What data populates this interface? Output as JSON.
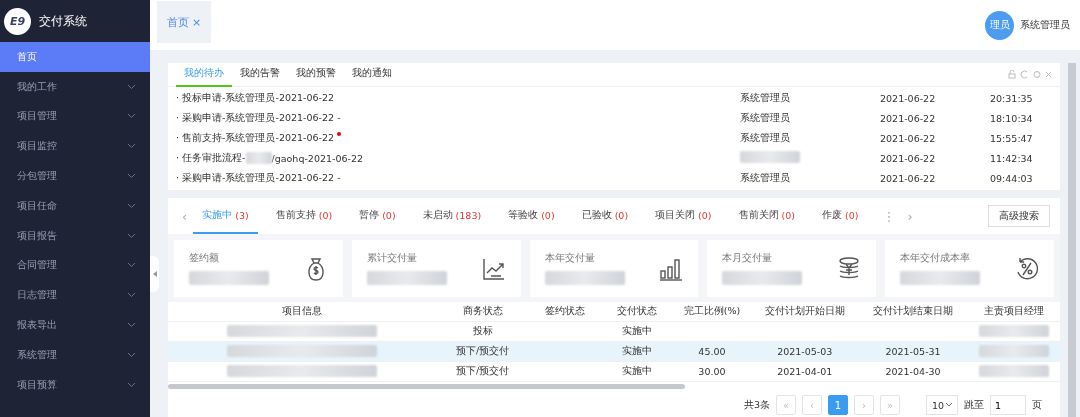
{
  "app": {
    "logo": "E9",
    "title": "交付系统"
  },
  "sidebar": {
    "items": [
      {
        "label": "首页",
        "selected": true,
        "expandable": false
      },
      {
        "label": "我的工作",
        "selected": false,
        "expandable": true
      },
      {
        "label": "项目管理",
        "selected": false,
        "expandable": true
      },
      {
        "label": "项目监控",
        "selected": false,
        "expandable": true
      },
      {
        "label": "分包管理",
        "selected": false,
        "expandable": true
      },
      {
        "label": "项目任命",
        "selected": false,
        "expandable": true
      },
      {
        "label": "项目报告",
        "selected": false,
        "expandable": true
      },
      {
        "label": "合同管理",
        "selected": false,
        "expandable": true
      },
      {
        "label": "日志管理",
        "selected": false,
        "expandable": true
      },
      {
        "label": "报表导出",
        "selected": false,
        "expandable": true
      },
      {
        "label": "系统管理",
        "selected": false,
        "expandable": true
      },
      {
        "label": "项目预算",
        "selected": false,
        "expandable": true
      }
    ]
  },
  "page_tabs": [
    {
      "label": "首页",
      "close": "×",
      "selected": true
    }
  ],
  "user": {
    "avatar": "理员",
    "name": "系统管理员"
  },
  "todo_panel": {
    "bullet": "·",
    "tabs": [
      {
        "label": "我的待办",
        "selected": true
      },
      {
        "label": "我的告警",
        "selected": false
      },
      {
        "label": "我的预警",
        "selected": false
      },
      {
        "label": "我的通知",
        "selected": false
      }
    ],
    "items": [
      {
        "title": "投标申请-系统管理员-2021-06-22",
        "unread": false,
        "user": "系统管理员",
        "date": "2021-06-22",
        "time": "20:31:35"
      },
      {
        "title": "采购申请-系统管理员-2021-06-22 -",
        "unread": false,
        "user": "系统管理员",
        "date": "2021-06-22",
        "time": "18:10:34"
      },
      {
        "title": "售前支持-系统管理员-2021-06-22",
        "unread": true,
        "user": "系统管理员",
        "date": "2021-06-22",
        "time": "15:55:47"
      },
      {
        "title": "任务审批流程-",
        "title_redacted": true,
        "title_tail": "/gaohq-2021-06-22",
        "unread": false,
        "user_redacted": true,
        "date": "2021-06-22",
        "time": "11:42:34"
      },
      {
        "title": "采购申请-系统管理员-2021-06-22 -",
        "unread": false,
        "user": "系统管理员",
        "date": "2021-06-22",
        "time": "09:44:03"
      }
    ]
  },
  "project_panel": {
    "prev": "‹",
    "tabs": [
      {
        "label": "实施中",
        "count": "(3)",
        "selected": true
      },
      {
        "label": "售前支持",
        "count": "(0)",
        "selected": false
      },
      {
        "label": "暂停",
        "count": "(0)",
        "selected": false
      },
      {
        "label": "未启动",
        "count": "(183)",
        "selected": false
      },
      {
        "label": "等验收",
        "count": "(0)",
        "selected": false
      },
      {
        "label": "已验收",
        "count": "(0)",
        "selected": false
      },
      {
        "label": "项目关闭",
        "count": "(0)",
        "selected": false
      },
      {
        "label": "售前关闭",
        "count": "(0)",
        "selected": false
      },
      {
        "label": "作废",
        "count": "(0)",
        "selected": false
      }
    ],
    "more": "⋮",
    "next": "›",
    "search_button": "高级搜索",
    "kpis": [
      {
        "label": "签约额",
        "kind": "bag"
      },
      {
        "label": "累计交付量",
        "kind": "trend"
      },
      {
        "label": "本年交付量",
        "kind": "bars"
      },
      {
        "label": "本月交付量",
        "kind": "coins"
      },
      {
        "label": "本年交付成本率",
        "kind": "percent"
      }
    ],
    "table": {
      "columns": [
        "项目信息",
        "商务状态",
        "签约状态",
        "交付状态",
        "完工比例(%)",
        "交付计划开始日期",
        "交付计划结束日期",
        "主责项目经理"
      ],
      "rows": [
        {
          "selected": false,
          "cells": [
            {
              "redacted": true
            },
            "投标",
            null,
            "实施中",
            null,
            null,
            null,
            {
              "redacted": true
            }
          ]
        },
        {
          "selected": true,
          "cells": [
            {
              "redacted": true
            },
            "预下/预交付",
            null,
            "实施中",
            "45.00",
            "2021-05-03",
            "2021-05-31",
            {
              "redacted": true
            }
          ]
        },
        {
          "selected": false,
          "cells": [
            {
              "redacted": true
            },
            "预下/预交付",
            null,
            "实施中",
            "30.00",
            "2021-04-01",
            "2021-04-30",
            {
              "redacted": true
            }
          ]
        }
      ]
    },
    "pagination": {
      "total": "共3条",
      "first": "«",
      "prev": "‹",
      "pages": [
        {
          "label": "1",
          "selected": true
        }
      ],
      "next": "›",
      "last": "»",
      "page_size": "10",
      "jump_label": "跳至",
      "jump_value": "1",
      "page_unit": "页"
    }
  }
}
